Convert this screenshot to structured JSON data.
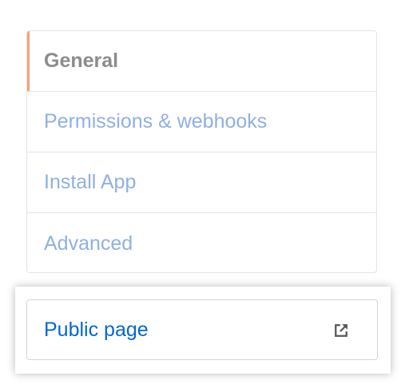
{
  "menu": {
    "items": [
      {
        "label": "General",
        "selected": true
      },
      {
        "label": "Permissions & webhooks",
        "selected": false
      },
      {
        "label": "Install App",
        "selected": false
      },
      {
        "label": "Advanced",
        "selected": false
      }
    ]
  },
  "public_link": {
    "label": "Public page",
    "icon": "external-link-icon"
  },
  "colors": {
    "selected_text": "#8c8c8c",
    "selected_indicator": "#f3a27d",
    "link_faded": "#8fb0e3",
    "link_active": "#0366d6",
    "border": "#e1e4e8"
  }
}
